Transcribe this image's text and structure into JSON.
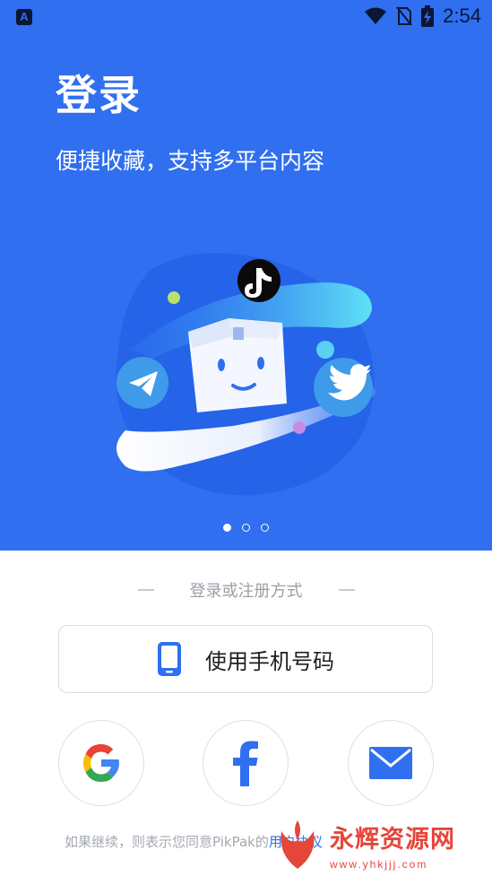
{
  "status_bar": {
    "notification_icon": "A",
    "time": "2:54",
    "icons": [
      "wifi-icon",
      "no-sim-icon",
      "battery-charging-icon"
    ]
  },
  "hero": {
    "title": "登录",
    "subtitle": "便捷收藏，支持多平台内容",
    "background_color": "#2f6ff0",
    "illustration_icons": [
      "tiktok-icon",
      "telegram-icon",
      "twitter-icon",
      "box-mascot"
    ],
    "pager": {
      "count": 3,
      "active_index": 0
    }
  },
  "login": {
    "divider_text": "登录或注册方式",
    "phone_button_label": "使用手机号码",
    "social_buttons": [
      "google-icon",
      "facebook-icon",
      "email-icon"
    ]
  },
  "legal": {
    "text_prefix": "如果继续，则表示您同意PikPak的",
    "link_text": "用户协议"
  },
  "watermark": {
    "text": "永辉资源网",
    "url": "www.yhkjjj.com"
  }
}
